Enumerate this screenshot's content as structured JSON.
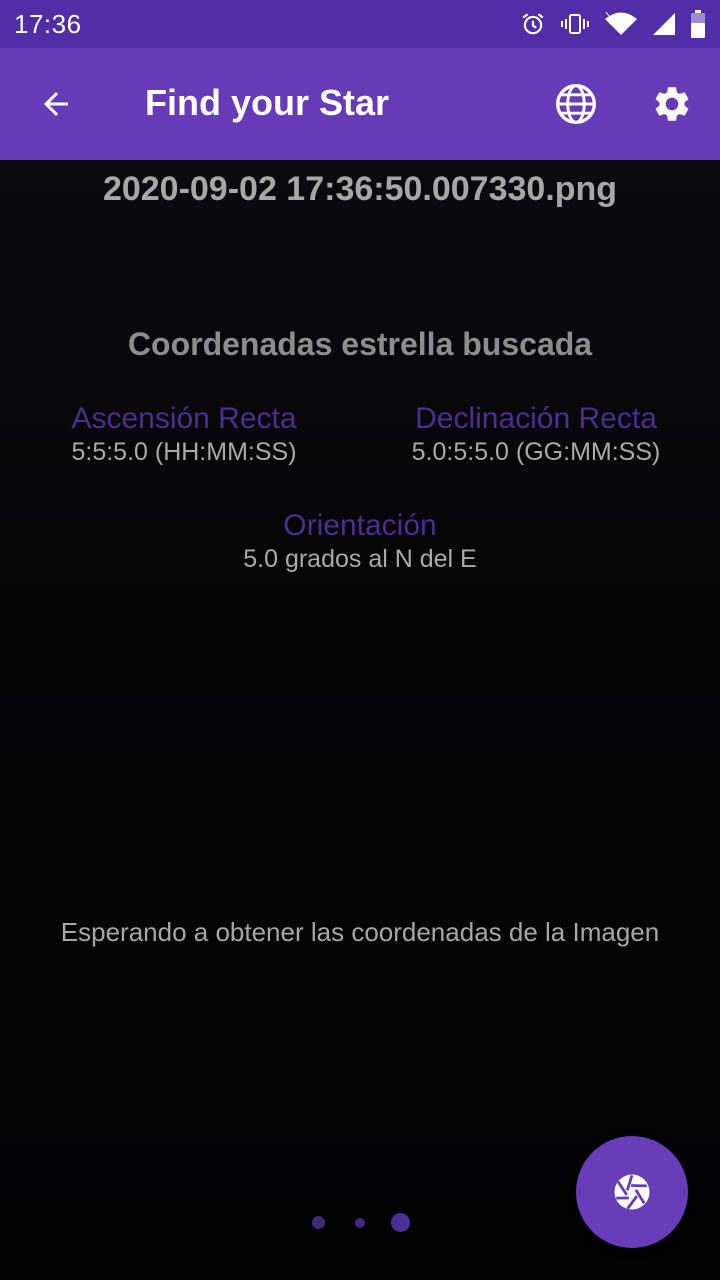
{
  "status_bar": {
    "time": "17:36",
    "icons": [
      "alarm-icon",
      "vibrate-icon",
      "wifi-icon",
      "signal-icon",
      "battery-icon"
    ]
  },
  "app_bar": {
    "title": "Find your Star",
    "back_icon": "arrow-back-icon",
    "actions": [
      "globe-icon",
      "gear-icon"
    ]
  },
  "main": {
    "filename": "2020-09-02 17:36:50.007330.png",
    "section_title": "Coordenadas estrella buscada",
    "ra": {
      "label": "Ascensión Recta",
      "value": "5:5:5.0 (HH:MM:SS)"
    },
    "dec": {
      "label": "Declinación Recta",
      "value": "5.0:5:5.0 (GG:MM:SS)"
    },
    "orientation": {
      "label": "Orientación",
      "value": "5.0 grados al N del E"
    },
    "waiting_text": "Esperando a obtener las coordenadas de la Imagen"
  },
  "pager": {
    "count": 3,
    "active_index": 2
  },
  "fab": {
    "icon": "camera-shutter-icon"
  },
  "colors": {
    "primary": "#673ab7",
    "primary_dark": "#512da8",
    "label_purple": "#4a2f8f",
    "background": "#000000"
  }
}
